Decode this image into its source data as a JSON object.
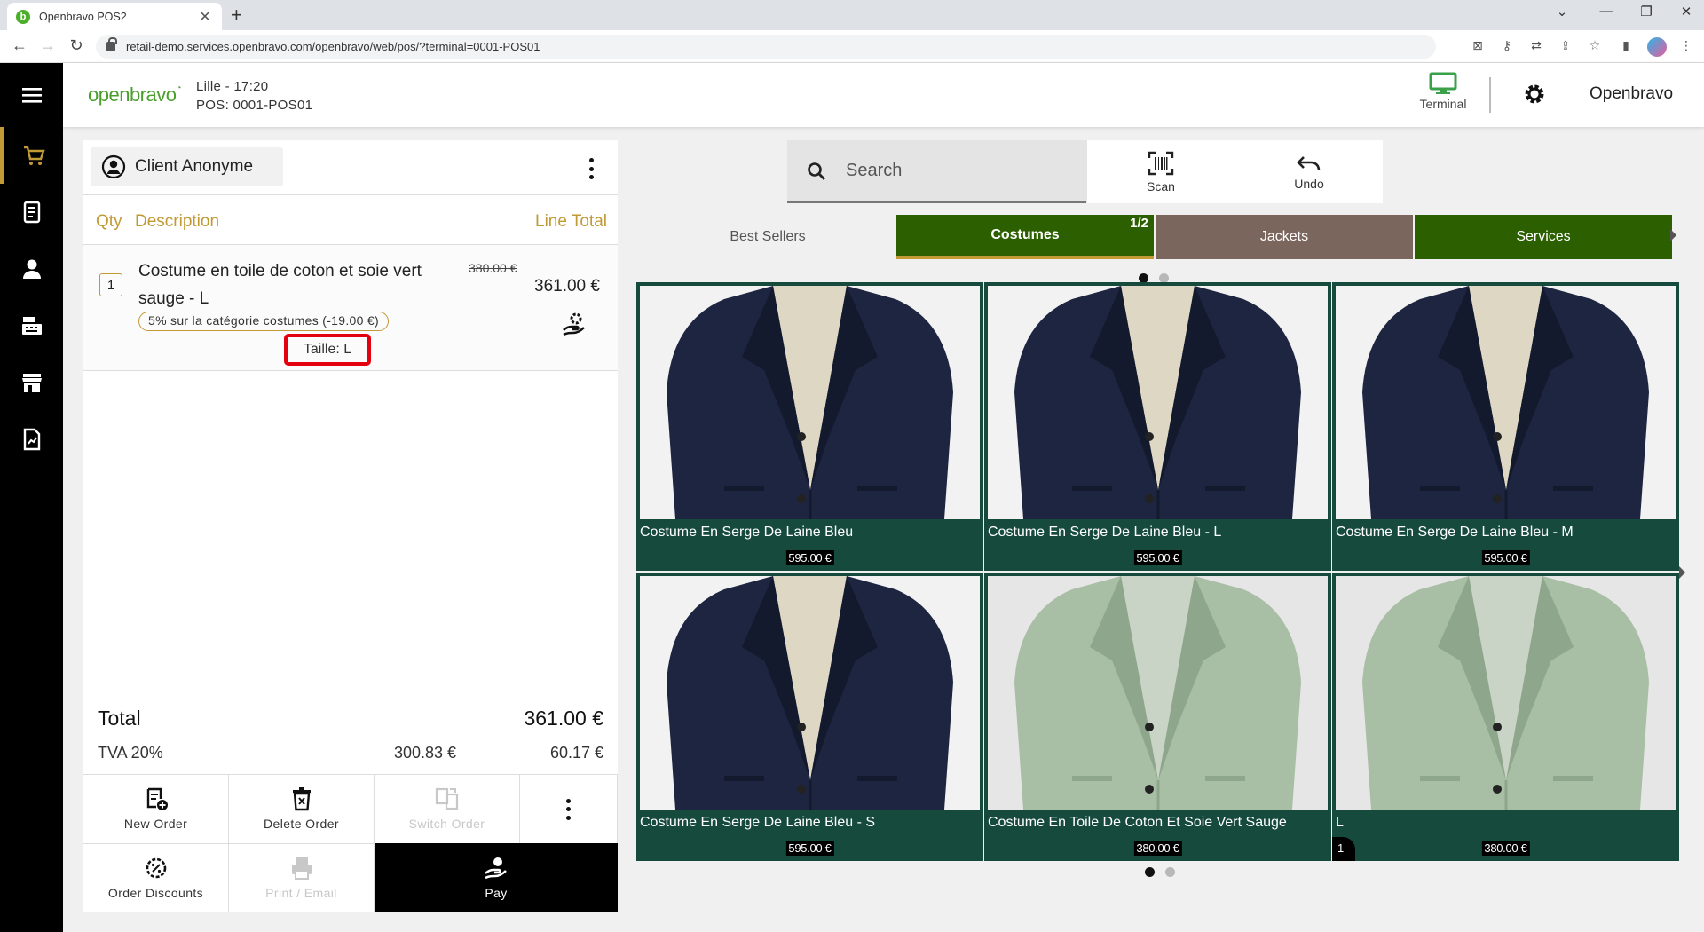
{
  "browser": {
    "tab_title": "Openbravo POS2",
    "url": "retail-demo.services.openbravo.com/openbravo/web/pos/?terminal=0001-POS01"
  },
  "header": {
    "logo": "openbravo",
    "store_line": "Lille - 17:20",
    "pos_line": "POS: 0001-POS01",
    "terminal_label": "Terminal",
    "user_name": "Openbravo"
  },
  "order": {
    "client": "Client Anonyme",
    "columns": {
      "qty": "Qty",
      "description": "Description",
      "line_total": "Line Total"
    },
    "lines": [
      {
        "qty": "1",
        "description": "Costume en toile de coton et soie vert sauge - L",
        "old_price": "380.00 €",
        "price": "361.00 €",
        "promotion": "5% sur la catégorie costumes (-19.00 €)",
        "attribute": "Taille: L"
      }
    ],
    "total_label": "Total",
    "total_value": "361.00 €",
    "tax_label": "TVA 20%",
    "tax_base": "300.83 €",
    "tax_amount": "60.17 €"
  },
  "actions": {
    "new_order": "New Order",
    "delete_order": "Delete Order",
    "switch_order": "Switch Order",
    "order_discounts": "Order Discounts",
    "print_email": "Print / Email",
    "pay": "Pay"
  },
  "catalog": {
    "search_placeholder": "Search",
    "scan_label": "Scan",
    "undo_label": "Undo",
    "categories": [
      {
        "label": "Best Sellers",
        "color": ""
      },
      {
        "label": "Costumes",
        "color": "#2c5f00",
        "page": "1/2"
      },
      {
        "label": "Jackets",
        "color": "#7b665e"
      },
      {
        "label": "Services",
        "color": "#2c5f00"
      }
    ],
    "products": [
      {
        "name": "Costume En Serge De Laine Bleu",
        "price": "595.00 €",
        "variant": "navy"
      },
      {
        "name": "Costume En Serge De Laine Bleu - L",
        "price": "595.00 €",
        "variant": "navy"
      },
      {
        "name": "Costume En Serge De Laine Bleu - M",
        "price": "595.00 €",
        "variant": "navy"
      },
      {
        "name": "Costume En Serge De Laine Bleu - S",
        "price": "595.00 €",
        "variant": "navy"
      },
      {
        "name": "Costume En Toile De Coton Et Soie Vert Sauge",
        "price": "380.00 €",
        "variant": "sage"
      },
      {
        "name": "L",
        "price": "380.00 €",
        "variant": "sage",
        "qty_badge": "1"
      }
    ]
  },
  "colors": {
    "accent": "#c19a36",
    "card_bg": "#154a3d",
    "highlight": "#e3000f",
    "brand_green": "#4a9f2d"
  }
}
